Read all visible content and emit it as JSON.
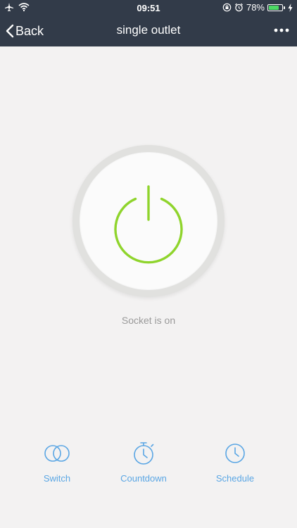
{
  "status_bar": {
    "time": "09:51",
    "battery_percent": "78%",
    "battery_level": 0.78,
    "battery_color": "#4cd964"
  },
  "nav": {
    "back_label": "Back",
    "title": "single outlet",
    "more_icon": "more-horizontal-icon"
  },
  "power": {
    "state_text": "Socket is on",
    "on_color": "#8fd42c",
    "icon": "power-icon"
  },
  "tabs": [
    {
      "label": "Switch",
      "icon": "switch-icon"
    },
    {
      "label": "Countdown",
      "icon": "stopwatch-icon"
    },
    {
      "label": "Schedule",
      "icon": "clock-icon"
    }
  ],
  "colors": {
    "header_bg": "#323b49",
    "page_bg": "#f3f2f2",
    "accent": "#5aa6e4"
  }
}
